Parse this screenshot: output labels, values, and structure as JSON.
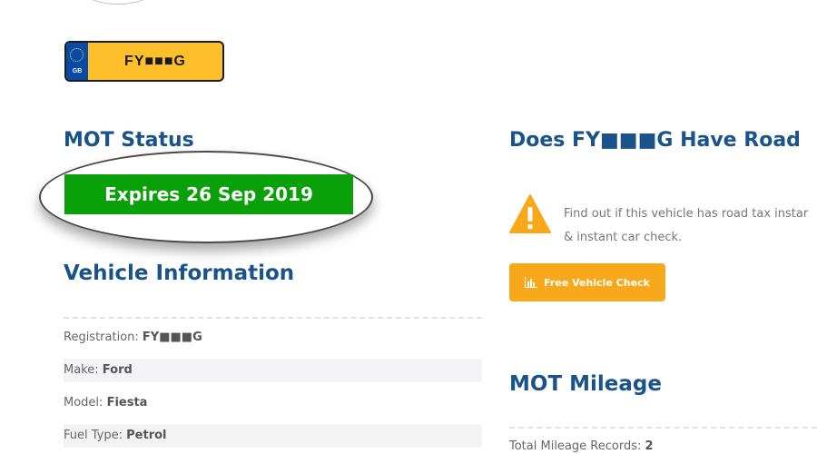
{
  "plate": {
    "country": "GB",
    "registration": "FY■■■G"
  },
  "mot_status": {
    "heading": "MOT Status",
    "expiry": "Expires 26 Sep 2019"
  },
  "vehicle_info": {
    "heading": "Vehicle Information",
    "rows": [
      {
        "label": "Registration:",
        "value": "FY■■■G"
      },
      {
        "label": "Make:",
        "value": "Ford"
      },
      {
        "label": "Model:",
        "value": "Fiesta"
      },
      {
        "label": "Fuel Type:",
        "value": "Petrol"
      }
    ]
  },
  "road_tax": {
    "heading": "Does FY■■■G Have Road",
    "line1": "Find out if this vehicle has road tax instar",
    "line2": "& instant car check.",
    "button_label": "Free Vehicle Check",
    "icon": "warning-triangle-icon",
    "accent_color": "#f7a81b"
  },
  "mot_mileage": {
    "heading": "MOT Mileage",
    "records_label": "Total Mileage Records:",
    "records_value": "2"
  },
  "colors": {
    "heading": "#19538a",
    "expiry_badge": "#0aa00a",
    "plate_yellow": "#ffbf2a",
    "plate_blue": "#0a4aa6"
  }
}
